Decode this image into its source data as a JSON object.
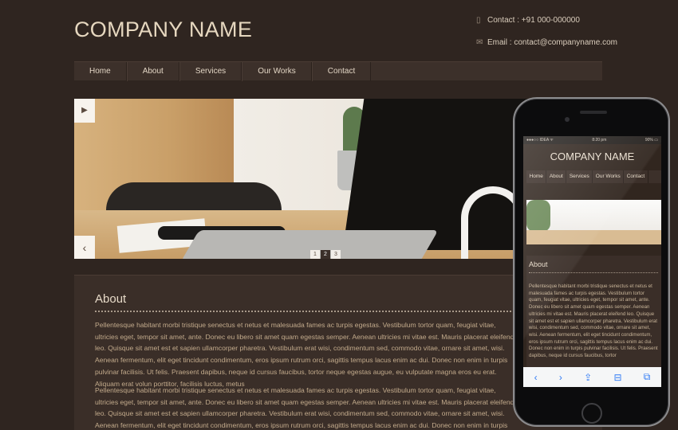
{
  "header": {
    "company_name": "COMPANY NAME",
    "phone_icon": "phone-icon",
    "phone": "Contact : +91 000-000000",
    "email_icon": "envelope-icon",
    "email": "Email : contact@companyname.com"
  },
  "nav": {
    "items": [
      {
        "label": "Home"
      },
      {
        "label": "About"
      },
      {
        "label": "Services"
      },
      {
        "label": "Our Works"
      },
      {
        "label": "Contact"
      }
    ]
  },
  "slider": {
    "play_icon": "play-icon",
    "prev_icon": "chevron-left-icon",
    "pages": [
      "1",
      "2",
      "3"
    ],
    "active_page": "2"
  },
  "about": {
    "heading": "About",
    "paragraph1": "Pellentesque habitant morbi tristique senectus et netus et malesuada fames ac turpis egestas. Vestibulum tortor quam, feugiat vitae, ultricies eget, tempor sit amet, ante. Donec eu libero sit amet quam egestas semper. Aenean ultricies mi vitae est. Mauris placerat eleifend leo. Quisque sit amet est et sapien ullamcorper pharetra. Vestibulum erat wisi, condimentum sed, commodo vitae, ornare sit amet, wisi. Aenean fermentum, elit eget tincidunt condimentum, eros ipsum rutrum orci, sagittis tempus lacus enim ac dui. Donec non enim in turpis pulvinar facilisis. Ut felis. Praesent dapibus, neque id cursus faucibus, tortor neque egestas augue, eu vulputate magna eros eu erat. Aliquam erat volun porttitor, facilisis luctus, metus",
    "paragraph2": "Pellentesque habitant morbi tristique senectus et netus et malesuada fames ac turpis egestas. Vestibulum tortor quam, feugiat vitae, ultricies eget, tempor sit amet, ante. Donec eu libero sit amet quam egestas semper. Aenean ultricies mi vitae est. Mauris placerat eleifend leo. Quisque sit amet est et sapien ullamcorper pharetra. Vestibulum erat wisi, condimentum sed, commodo vitae, ornare sit amet, wisi. Aenean fermentum, elit eget tincidunt condimentum, eros ipsum rutrum orci, sagittis tempus lacus enim ac dui. Donec non enim in turpis pulvinar facilisis. Ut felis. Praesent dapibus, neque id cursus faucibus, tortor"
  },
  "mobile": {
    "status_left": "●●●○○ IDEA ᯤ",
    "status_time": "8:20 pm",
    "status_right": "90% ▭",
    "company_name": "COMPANY NAME",
    "nav": [
      "Home",
      "About",
      "Services",
      "Our Works",
      "Contact"
    ],
    "about_heading": "About",
    "about_text": "Pellentesque habitant morbi tristique senectus et netus et malesuada fames ac turpis egestas. Vestibulum tortor quam, feugiat vitae, ultricies eget, tempor sit amet, ante. Donec eu libero sit amet quam egestas semper. Aenean ultricies mi vitae est. Mauris placerat eleifend leo. Quisque sit amet est et sapien ullamcorper pharetra. Vestibulum erat wisi, condimentum sed, commodo vitae, ornare sit amet, wisi. Aenean fermentum, elit eget tincidunt condimentum, eros ipsum rutrum orci, sagittis tempus lacus enim ac dui. Donec non enim in turpis pulvinar facilisis. Ut felis. Praesent dapibus, neque id cursus faucibus, tortor",
    "toolbar": [
      {
        "icon": "back-icon",
        "glyph": "‹"
      },
      {
        "icon": "forward-icon",
        "glyph": "›"
      },
      {
        "icon": "share-icon",
        "glyph": "⇪"
      },
      {
        "icon": "bookmarks-icon",
        "glyph": "⊟"
      },
      {
        "icon": "tabs-icon",
        "glyph": "⧉"
      }
    ]
  }
}
